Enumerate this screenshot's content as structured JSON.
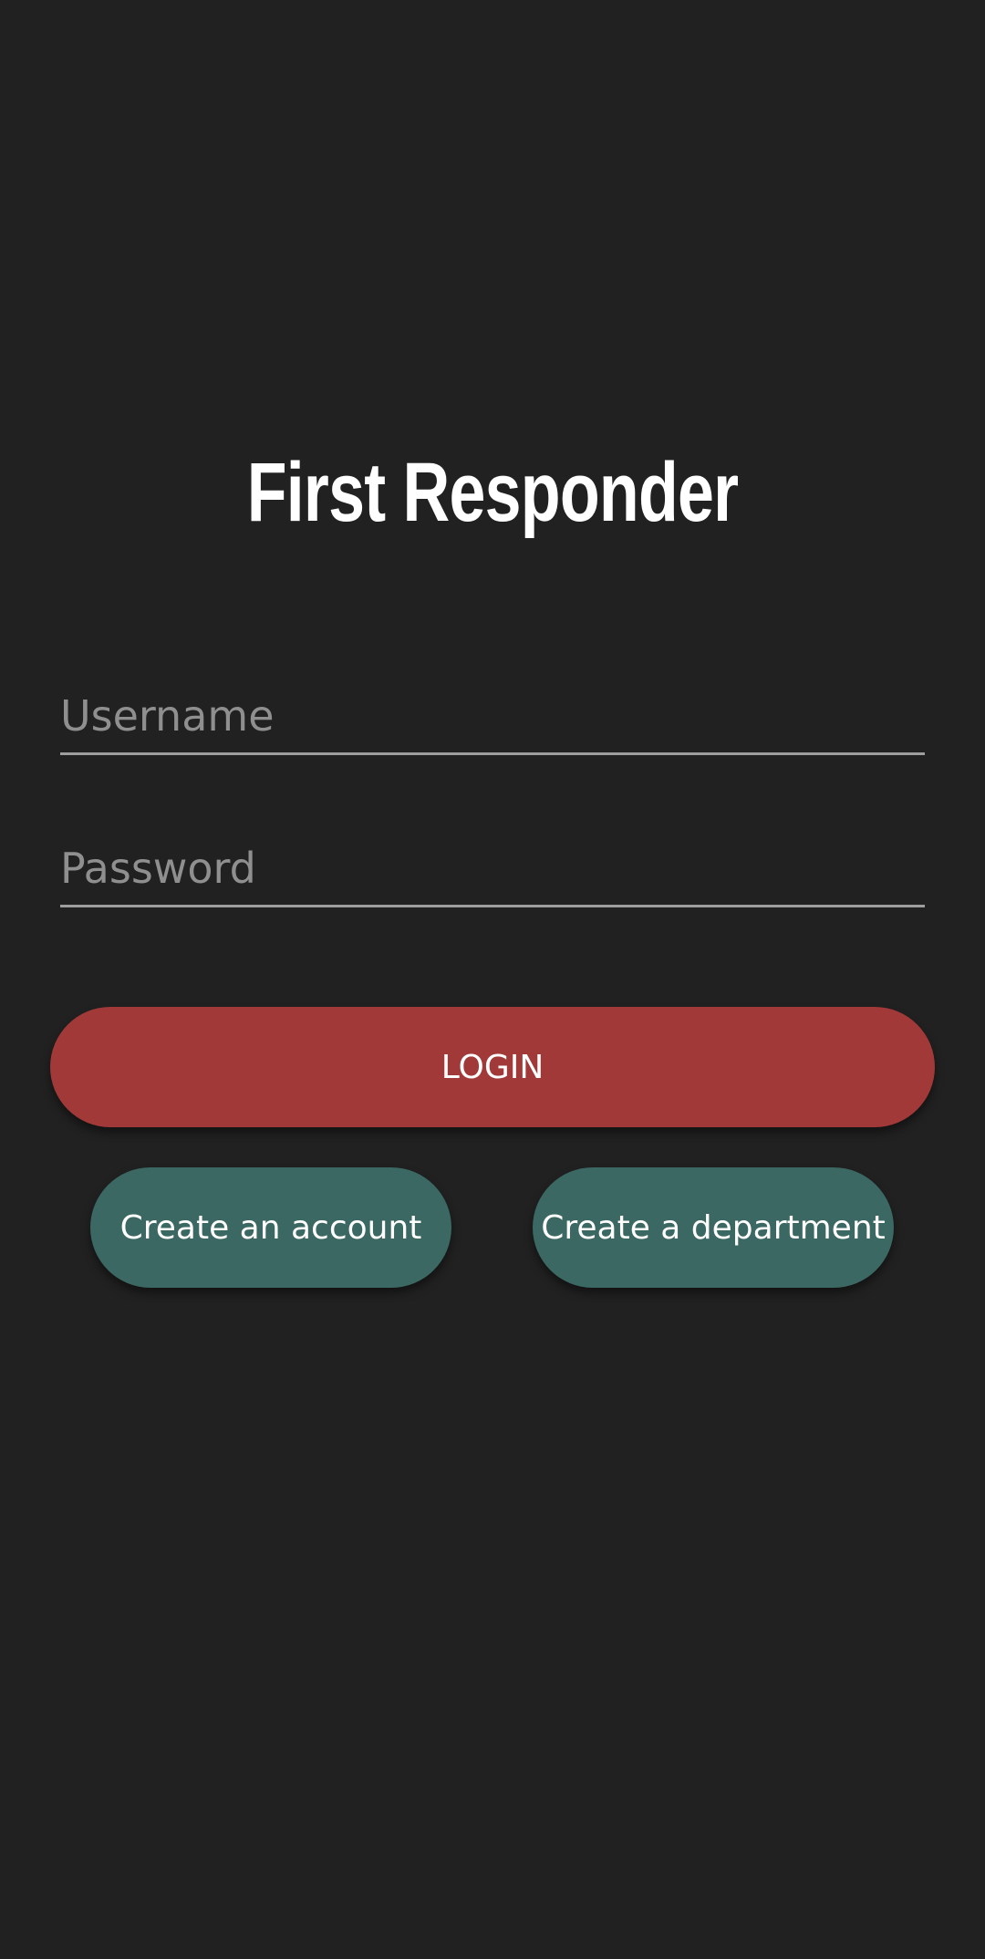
{
  "app": {
    "title": "First Responder"
  },
  "form": {
    "username_placeholder": "Username",
    "password_placeholder": "Password",
    "login_label": "LOGIN"
  },
  "actions": {
    "create_account_label": "Create an account",
    "create_department_label": "Create a department"
  },
  "colors": {
    "background": "#212121",
    "login_button": "#a23939",
    "secondary_button": "#3b6862",
    "field_underline": "#9e9e9e"
  }
}
